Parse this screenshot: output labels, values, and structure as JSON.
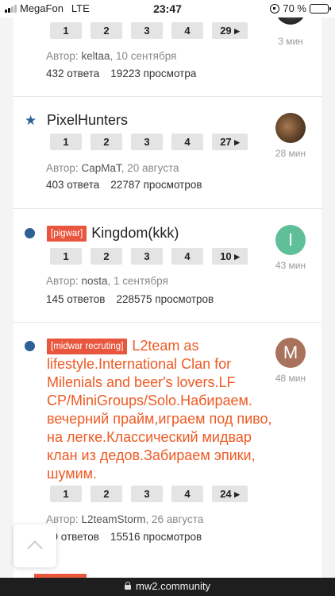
{
  "status_bar": {
    "carrier": "MegaFon",
    "network": "LTE",
    "time": "23:47",
    "battery_text": "70 %",
    "battery_level": 0.7,
    "battery_color": "#f5c400"
  },
  "url_bar": {
    "domain": "mw2.community",
    "icon": "lock-icon"
  },
  "colors": {
    "accent": "#2e5f96",
    "hot_title": "#ee5a24",
    "prefix_bg": "#e8563e"
  },
  "topics": [
    {
      "title": "",
      "prefix": "",
      "marker": "none",
      "pages": [
        "1",
        "2",
        "3",
        "4",
        "29 ▸"
      ],
      "author_label": "Автор:",
      "author": "keltaa",
      "date": ", 10 сентября",
      "replies": "432 ответа",
      "views": "19223 просмотра",
      "time_ago": "3 мин",
      "avatar": ""
    },
    {
      "title": "PixelHunters",
      "prefix": "",
      "marker": "star-icon",
      "pages": [
        "1",
        "2",
        "3",
        "4",
        "27 ▸"
      ],
      "author_label": "Автор:",
      "author": "CapMaT",
      "date": ", 20 августа",
      "replies": "403 ответа",
      "views": "22787 просмотров",
      "time_ago": "28 мин",
      "avatar": ""
    },
    {
      "title": "Kingdom(kkk)",
      "prefix": "[pigwar]",
      "marker": "unread-dot-icon",
      "pages": [
        "1",
        "2",
        "3",
        "4",
        "10 ▸"
      ],
      "author_label": "Автор:",
      "author": "nosta",
      "date": ", 1 сентября",
      "replies": "145 ответов",
      "views": "228575 просмотров",
      "time_ago": "43 мин",
      "avatar": "I",
      "avatar_color": "#5fbf99"
    },
    {
      "title": "L2team as lifestyle.International Clan for Milenials and beer's lovers.LF CP/MiniGroups/Solo.Набираем. вечерний прайм,играем под пиво, на легке.Классический мидвар клан из дедов.Забираем эпики, шумим.",
      "prefix": "[midwar recruting]",
      "marker": "unread-dot-icon",
      "pages": [
        "1",
        "2",
        "3",
        "4",
        "24 ▸"
      ],
      "author_label": "Автор:",
      "author": "L2teamStorm",
      "date": ", 26 августа",
      "replies": "59 ответов",
      "views": "15516 просмотров",
      "time_ago": "48 мин",
      "avatar": "M",
      "avatar_color": "#a8725c"
    }
  ]
}
